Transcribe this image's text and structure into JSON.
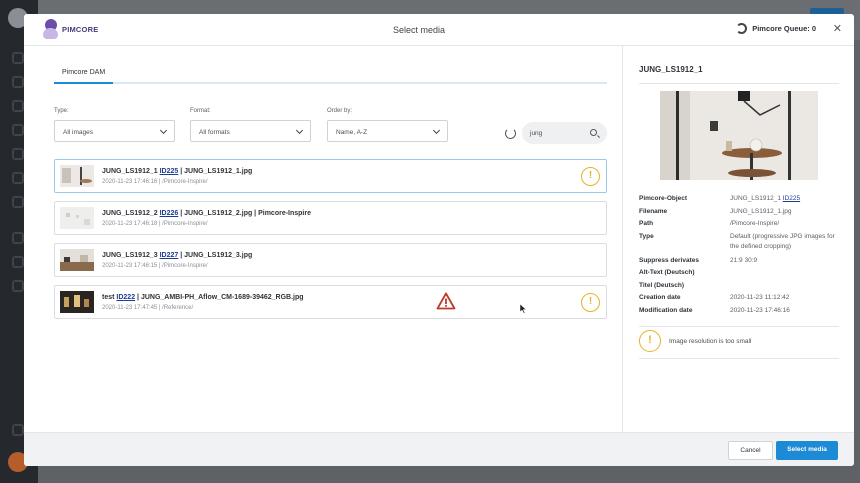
{
  "modal": {
    "brand": "PIMCORE",
    "title": "Select media",
    "queue_label": "Pimcore Queue: 0",
    "close_glyph": "✕"
  },
  "left": {
    "tab": "Pimcore DAM",
    "filters": {
      "type_label": "Type:",
      "type_value": "All images",
      "format_label": "Format:",
      "format_value": "All formats",
      "order_label": "Order by:",
      "order_value": "Name, A-Z"
    },
    "search_value": "jung",
    "rows": [
      {
        "name": "JUNG_LS1912_1",
        "id": "ID225",
        "file": "| JUNG_LS1912_1.jpg",
        "sub": "2020-11-23 17:46:16 | /Pimcore-Inspire/",
        "warn": "!"
      },
      {
        "name": "JUNG_LS1912_2",
        "id": "ID226",
        "file": "| JUNG_LS1912_2.jpg | Pimcore-Inspire",
        "sub": "2020-11-23 17:46:18 | /Pimcore-Inspire/"
      },
      {
        "name": "JUNG_LS1912_3",
        "id": "ID227",
        "file": "| JUNG_LS1912_3.jpg",
        "sub": "2020-11-23 17:46:15 | /Pimcore-Inspire/"
      },
      {
        "name": "test",
        "id": "ID222",
        "file": "| JUNG_AMBI-PH_Aflow_CM-1689-39462_RGB.jpg",
        "sub": "2020-11-23 17:47:45 | /Reference/",
        "warn": "!"
      }
    ]
  },
  "detail": {
    "title": "JUNG_LS1912_1",
    "props": [
      {
        "k": "Pimcore-Object",
        "v": "JUNG_LS1912_1",
        "link": "ID225"
      },
      {
        "k": "Filename",
        "v": "JUNG_LS1912_1.jpg"
      },
      {
        "k": "Path",
        "v": "/Pimcore-Inspire/"
      },
      {
        "k": "Type",
        "v": "Default (progressive JPG images for the defined cropping)"
      },
      {
        "k": "Suppress derivates",
        "v": "21:9 30:9"
      },
      {
        "k": "Alt-Text (Deutsch)",
        "v": ""
      },
      {
        "k": "Titel (Deutsch)",
        "v": ""
      },
      {
        "k": "Creation date",
        "v": "2020-11-23 11:12:42"
      },
      {
        "k": "Modification date",
        "v": "2020-11-23 17:46:16"
      }
    ],
    "warning": "Image resolution is too small",
    "warn_glyph": "!"
  },
  "footer": {
    "cancel": "Cancel",
    "select": "Select media"
  },
  "colors": {
    "accent": "#1d8ad6",
    "warning": "#e5b22a",
    "error": "#c0392b"
  }
}
